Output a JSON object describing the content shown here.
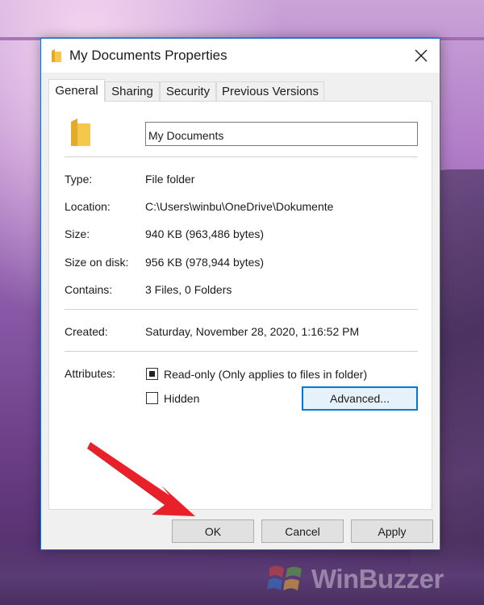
{
  "window": {
    "title": "My Documents Properties",
    "close_icon": "close-icon"
  },
  "tabs": [
    {
      "label": "General",
      "active": true
    },
    {
      "label": "Sharing",
      "active": false
    },
    {
      "label": "Security",
      "active": false
    },
    {
      "label": "Previous Versions",
      "active": false
    }
  ],
  "general": {
    "folder_name": "My Documents",
    "rows": {
      "type": {
        "label": "Type:",
        "value": "File folder"
      },
      "location": {
        "label": "Location:",
        "value": "C:\\Users\\winbu\\OneDrive\\Dokumente"
      },
      "size": {
        "label": "Size:",
        "value": "940 KB (963,486 bytes)"
      },
      "size_on_disk": {
        "label": "Size on disk:",
        "value": "956 KB (978,944 bytes)"
      },
      "contains": {
        "label": "Contains:",
        "value": "3 Files, 0 Folders"
      },
      "created": {
        "label": "Created:",
        "value": "Saturday, November 28, 2020, 1:16:52 PM"
      }
    },
    "attributes": {
      "label": "Attributes:",
      "readonly": {
        "label": "Read-only (Only applies to files in folder)",
        "state": "indeterminate"
      },
      "hidden": {
        "label": "Hidden",
        "checked": false
      },
      "advanced_label": "Advanced..."
    }
  },
  "footer": {
    "ok_label": "OK",
    "cancel_label": "Cancel",
    "apply_label": "Apply"
  },
  "watermark": {
    "text": "WinBuzzer"
  },
  "colors": {
    "accent": "#0078d7",
    "arrow": "#e8202a",
    "folder": "#f5c84c"
  }
}
